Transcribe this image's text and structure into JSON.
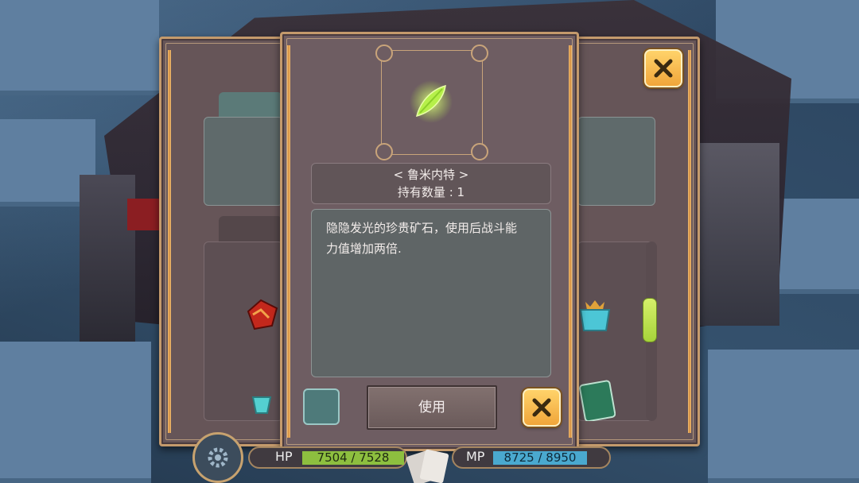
{
  "item_dialog": {
    "item_name": "< 鲁米内特 >",
    "quantity_line": "持有数量 : 1",
    "description_line1": "隐隐发光的珍贵矿石，使用后战斗能",
    "description_line2": "力值增加两倍.",
    "use_label": "使用",
    "item_icon": "green-crystal-icon"
  },
  "hud": {
    "hp_label": "HP",
    "hp_value": "7504 / 7528",
    "hp_ratio": 0.997,
    "mp_label": "MP",
    "mp_value": "8725 / 8950",
    "mp_ratio": 0.975
  },
  "colors": {
    "panel": "#6e5d62",
    "gold_border": "#c49a6c",
    "close_button": "#f0a53a",
    "hp_fill": "#8dbf3f",
    "mp_fill": "#4aa9cf",
    "crystal": "#b6f04a"
  }
}
